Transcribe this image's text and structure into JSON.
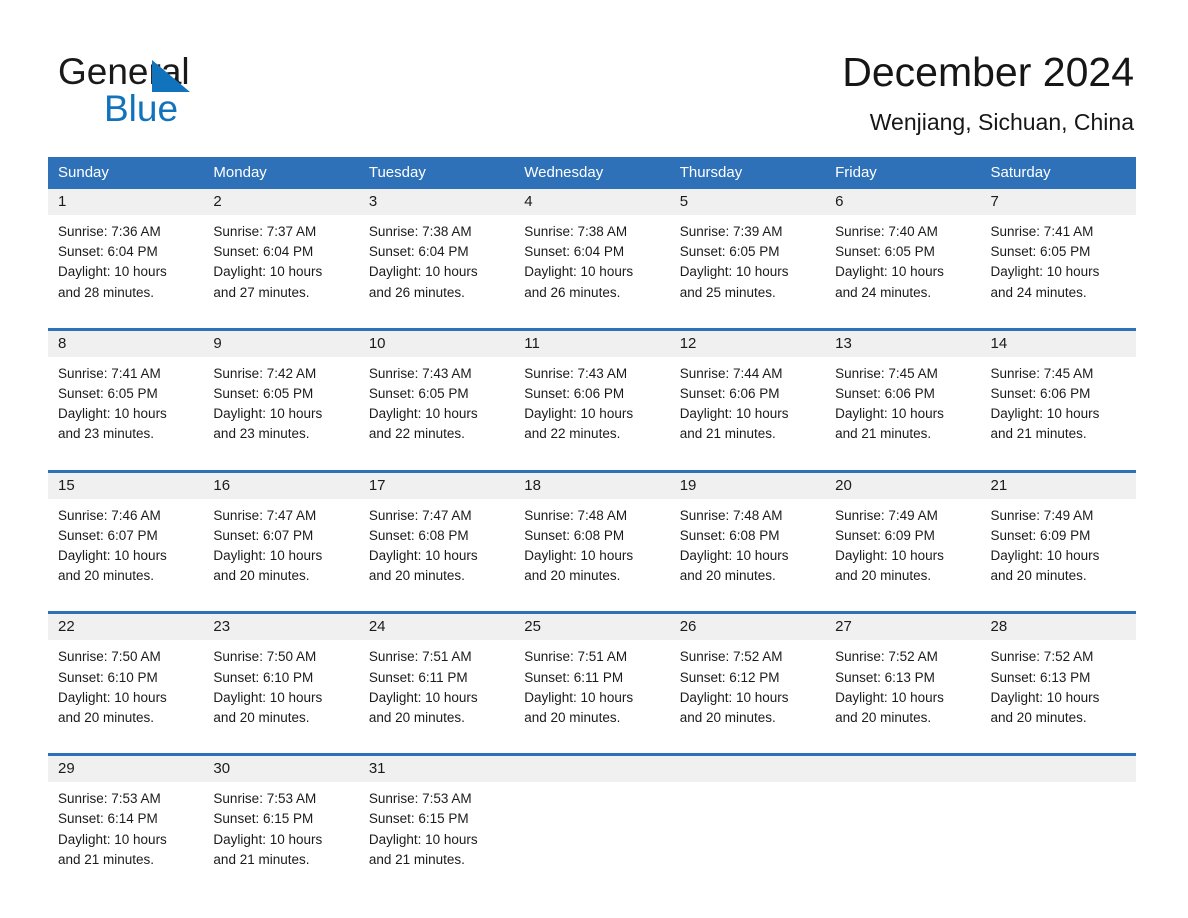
{
  "brand": {
    "line1": "General",
    "line2": "Blue",
    "triangle_color": "#1273bd"
  },
  "header": {
    "title": "December 2024",
    "location": "Wenjiang, Sichuan, China"
  },
  "colors": {
    "header_blue": "#2e71b8",
    "day_band_gray": "#f0f0f0",
    "text": "#1b1b1b"
  },
  "weekdays": [
    "Sunday",
    "Monday",
    "Tuesday",
    "Wednesday",
    "Thursday",
    "Friday",
    "Saturday"
  ],
  "weeks": [
    [
      {
        "day": "1",
        "sunrise": "Sunrise: 7:36 AM",
        "sunset": "Sunset: 6:04 PM",
        "daylight1": "Daylight: 10 hours",
        "daylight2": "and 28 minutes."
      },
      {
        "day": "2",
        "sunrise": "Sunrise: 7:37 AM",
        "sunset": "Sunset: 6:04 PM",
        "daylight1": "Daylight: 10 hours",
        "daylight2": "and 27 minutes."
      },
      {
        "day": "3",
        "sunrise": "Sunrise: 7:38 AM",
        "sunset": "Sunset: 6:04 PM",
        "daylight1": "Daylight: 10 hours",
        "daylight2": "and 26 minutes."
      },
      {
        "day": "4",
        "sunrise": "Sunrise: 7:38 AM",
        "sunset": "Sunset: 6:04 PM",
        "daylight1": "Daylight: 10 hours",
        "daylight2": "and 26 minutes."
      },
      {
        "day": "5",
        "sunrise": "Sunrise: 7:39 AM",
        "sunset": "Sunset: 6:05 PM",
        "daylight1": "Daylight: 10 hours",
        "daylight2": "and 25 minutes."
      },
      {
        "day": "6",
        "sunrise": "Sunrise: 7:40 AM",
        "sunset": "Sunset: 6:05 PM",
        "daylight1": "Daylight: 10 hours",
        "daylight2": "and 24 minutes."
      },
      {
        "day": "7",
        "sunrise": "Sunrise: 7:41 AM",
        "sunset": "Sunset: 6:05 PM",
        "daylight1": "Daylight: 10 hours",
        "daylight2": "and 24 minutes."
      }
    ],
    [
      {
        "day": "8",
        "sunrise": "Sunrise: 7:41 AM",
        "sunset": "Sunset: 6:05 PM",
        "daylight1": "Daylight: 10 hours",
        "daylight2": "and 23 minutes."
      },
      {
        "day": "9",
        "sunrise": "Sunrise: 7:42 AM",
        "sunset": "Sunset: 6:05 PM",
        "daylight1": "Daylight: 10 hours",
        "daylight2": "and 23 minutes."
      },
      {
        "day": "10",
        "sunrise": "Sunrise: 7:43 AM",
        "sunset": "Sunset: 6:05 PM",
        "daylight1": "Daylight: 10 hours",
        "daylight2": "and 22 minutes."
      },
      {
        "day": "11",
        "sunrise": "Sunrise: 7:43 AM",
        "sunset": "Sunset: 6:06 PM",
        "daylight1": "Daylight: 10 hours",
        "daylight2": "and 22 minutes."
      },
      {
        "day": "12",
        "sunrise": "Sunrise: 7:44 AM",
        "sunset": "Sunset: 6:06 PM",
        "daylight1": "Daylight: 10 hours",
        "daylight2": "and 21 minutes."
      },
      {
        "day": "13",
        "sunrise": "Sunrise: 7:45 AM",
        "sunset": "Sunset: 6:06 PM",
        "daylight1": "Daylight: 10 hours",
        "daylight2": "and 21 minutes."
      },
      {
        "day": "14",
        "sunrise": "Sunrise: 7:45 AM",
        "sunset": "Sunset: 6:06 PM",
        "daylight1": "Daylight: 10 hours",
        "daylight2": "and 21 minutes."
      }
    ],
    [
      {
        "day": "15",
        "sunrise": "Sunrise: 7:46 AM",
        "sunset": "Sunset: 6:07 PM",
        "daylight1": "Daylight: 10 hours",
        "daylight2": "and 20 minutes."
      },
      {
        "day": "16",
        "sunrise": "Sunrise: 7:47 AM",
        "sunset": "Sunset: 6:07 PM",
        "daylight1": "Daylight: 10 hours",
        "daylight2": "and 20 minutes."
      },
      {
        "day": "17",
        "sunrise": "Sunrise: 7:47 AM",
        "sunset": "Sunset: 6:08 PM",
        "daylight1": "Daylight: 10 hours",
        "daylight2": "and 20 minutes."
      },
      {
        "day": "18",
        "sunrise": "Sunrise: 7:48 AM",
        "sunset": "Sunset: 6:08 PM",
        "daylight1": "Daylight: 10 hours",
        "daylight2": "and 20 minutes."
      },
      {
        "day": "19",
        "sunrise": "Sunrise: 7:48 AM",
        "sunset": "Sunset: 6:08 PM",
        "daylight1": "Daylight: 10 hours",
        "daylight2": "and 20 minutes."
      },
      {
        "day": "20",
        "sunrise": "Sunrise: 7:49 AM",
        "sunset": "Sunset: 6:09 PM",
        "daylight1": "Daylight: 10 hours",
        "daylight2": "and 20 minutes."
      },
      {
        "day": "21",
        "sunrise": "Sunrise: 7:49 AM",
        "sunset": "Sunset: 6:09 PM",
        "daylight1": "Daylight: 10 hours",
        "daylight2": "and 20 minutes."
      }
    ],
    [
      {
        "day": "22",
        "sunrise": "Sunrise: 7:50 AM",
        "sunset": "Sunset: 6:10 PM",
        "daylight1": "Daylight: 10 hours",
        "daylight2": "and 20 minutes."
      },
      {
        "day": "23",
        "sunrise": "Sunrise: 7:50 AM",
        "sunset": "Sunset: 6:10 PM",
        "daylight1": "Daylight: 10 hours",
        "daylight2": "and 20 minutes."
      },
      {
        "day": "24",
        "sunrise": "Sunrise: 7:51 AM",
        "sunset": "Sunset: 6:11 PM",
        "daylight1": "Daylight: 10 hours",
        "daylight2": "and 20 minutes."
      },
      {
        "day": "25",
        "sunrise": "Sunrise: 7:51 AM",
        "sunset": "Sunset: 6:11 PM",
        "daylight1": "Daylight: 10 hours",
        "daylight2": "and 20 minutes."
      },
      {
        "day": "26",
        "sunrise": "Sunrise: 7:52 AM",
        "sunset": "Sunset: 6:12 PM",
        "daylight1": "Daylight: 10 hours",
        "daylight2": "and 20 minutes."
      },
      {
        "day": "27",
        "sunrise": "Sunrise: 7:52 AM",
        "sunset": "Sunset: 6:13 PM",
        "daylight1": "Daylight: 10 hours",
        "daylight2": "and 20 minutes."
      },
      {
        "day": "28",
        "sunrise": "Sunrise: 7:52 AM",
        "sunset": "Sunset: 6:13 PM",
        "daylight1": "Daylight: 10 hours",
        "daylight2": "and 20 minutes."
      }
    ],
    [
      {
        "day": "29",
        "sunrise": "Sunrise: 7:53 AM",
        "sunset": "Sunset: 6:14 PM",
        "daylight1": "Daylight: 10 hours",
        "daylight2": "and 21 minutes."
      },
      {
        "day": "30",
        "sunrise": "Sunrise: 7:53 AM",
        "sunset": "Sunset: 6:15 PM",
        "daylight1": "Daylight: 10 hours",
        "daylight2": "and 21 minutes."
      },
      {
        "day": "31",
        "sunrise": "Sunrise: 7:53 AM",
        "sunset": "Sunset: 6:15 PM",
        "daylight1": "Daylight: 10 hours",
        "daylight2": "and 21 minutes."
      },
      {
        "day": "",
        "sunrise": "",
        "sunset": "",
        "daylight1": "",
        "daylight2": ""
      },
      {
        "day": "",
        "sunrise": "",
        "sunset": "",
        "daylight1": "",
        "daylight2": ""
      },
      {
        "day": "",
        "sunrise": "",
        "sunset": "",
        "daylight1": "",
        "daylight2": ""
      },
      {
        "day": "",
        "sunrise": "",
        "sunset": "",
        "daylight1": "",
        "daylight2": ""
      }
    ]
  ]
}
